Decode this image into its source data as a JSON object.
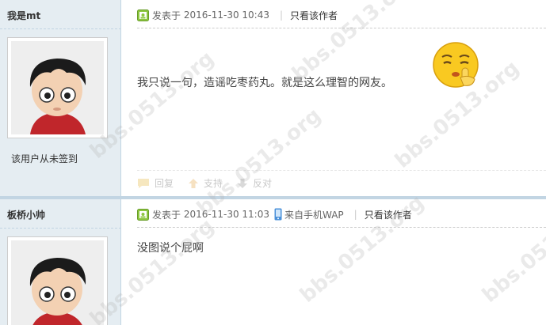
{
  "posts": [
    {
      "author": "我是mt",
      "signin_status": "该用户从未签到",
      "meta": {
        "posted_label": "发表于",
        "datetime": "2016-11-30 10:43",
        "only_author": "只看该作者"
      },
      "content": "我只说一句，造谣吃枣药丸。就是这么理智的网友。",
      "actions": {
        "reply": "回复",
        "support": "支持",
        "oppose": "反对"
      }
    },
    {
      "author": "板桥小帅",
      "meta": {
        "posted_label": "发表于",
        "datetime": "2016-11-30 11:03",
        "via": "来自手机WAP",
        "only_author": "只看该作者"
      },
      "content": "没图说个屁啊"
    }
  ],
  "watermark": "bbs.0513.org",
  "colors": {
    "sidebar_bg": "#e5edf2",
    "border": "#c2d5e3",
    "online_icon": "#8cc63f",
    "emoji_face": "#f9c921"
  },
  "icons": [
    "online-icon",
    "phone-icon",
    "reply-icon",
    "support-icon",
    "oppose-icon",
    "shush-emoji-icon"
  ]
}
